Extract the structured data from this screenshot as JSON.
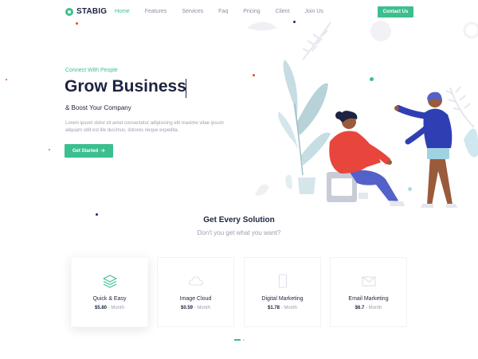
{
  "nav": {
    "logo_text": "STABIG",
    "items": [
      {
        "label": "Home",
        "active": true
      },
      {
        "label": "Features",
        "active": false
      },
      {
        "label": "Services",
        "active": false
      },
      {
        "label": "Faq",
        "active": false
      },
      {
        "label": "Pricing",
        "active": false
      },
      {
        "label": "Client",
        "active": false
      },
      {
        "label": "Join Us",
        "active": false
      }
    ],
    "contact_label": "Contact Us"
  },
  "hero": {
    "eyebrow": "Connect With People",
    "title": "Grow Business",
    "subtitle": "& Boost Your Company",
    "description": "Lorem ipsum dolor sit amet consectetur adipisicing elit maxime vitae ipsum aliquam odit est ille ducimus, dolores neque expedita.",
    "cta_label": "Get Started",
    "cta_icon": "arrow-right-icon"
  },
  "solutions": {
    "title": "Get Every Solution",
    "subtitle": "Don't you get what you want?",
    "cards": [
      {
        "title": "Quick & Easy",
        "price": "$5.80",
        "period": "- Month",
        "icon": "layers-icon",
        "active": true
      },
      {
        "title": "Image Cloud",
        "price": "$0.59",
        "period": "- Month",
        "icon": "cloud-icon",
        "active": false
      },
      {
        "title": "Digital Marketing",
        "price": "$1.78",
        "period": "- Month",
        "icon": "tablet-icon",
        "active": false
      },
      {
        "title": "Email Marketing",
        "price": "$6.7",
        "period": "- Month",
        "icon": "mail-icon",
        "active": false
      }
    ]
  },
  "colors": {
    "accent": "#3cbf8f",
    "navy": "#1d2340",
    "muted": "#9aa0b2"
  }
}
